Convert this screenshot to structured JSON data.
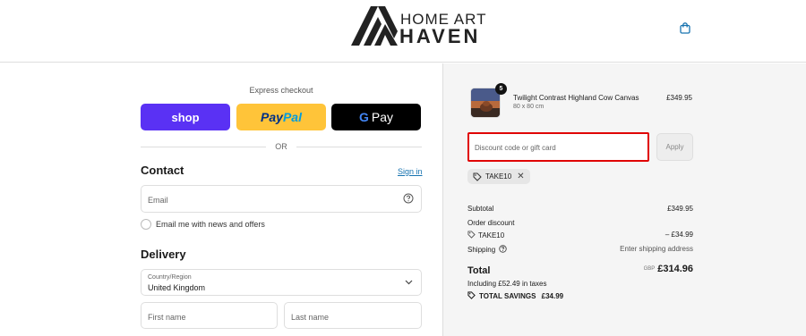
{
  "header": {
    "logo_line1": "HOME ART",
    "logo_line2": "HAVEN"
  },
  "express": {
    "title": "Express checkout",
    "shop_label": "shop",
    "paypal_part1": "Pay",
    "paypal_part2": "Pal",
    "gpay_g": "G",
    "gpay_label": "Pay",
    "or_label": "OR"
  },
  "contact": {
    "heading": "Contact",
    "signin_label": "Sign in",
    "email_placeholder": "Email",
    "newsletter_label": "Email me with news and offers"
  },
  "delivery": {
    "heading": "Delivery",
    "country_label": "Country/Region",
    "country_value": "United Kingdom",
    "first_name_placeholder": "First name",
    "last_name_placeholder": "Last name"
  },
  "order": {
    "quantity": "5",
    "product_name": "Twilight Contrast Highland Cow Canvas",
    "product_variant": "80 x 80 cm",
    "product_price": "£349.95",
    "discount_placeholder": "Discount code or gift card",
    "apply_label": "Apply",
    "applied_code": "TAKE10",
    "subtotal_label": "Subtotal",
    "subtotal_value": "£349.95",
    "order_discount_label": "Order discount",
    "discount_code": "TAKE10",
    "discount_value": "– £34.99",
    "shipping_label": "Shipping",
    "shipping_value": "Enter shipping address",
    "total_label": "Total",
    "total_currency": "GBP",
    "total_value": "£314.96",
    "tax_note": "Including £52.49 in taxes",
    "savings_label": "TOTAL SAVINGS",
    "savings_value": "£34.99"
  },
  "colors": {
    "shop": "#5a31f4",
    "paypal": "#ffc439",
    "gpay": "#000000",
    "link": "#1773b0",
    "highlight": "#e00000"
  }
}
